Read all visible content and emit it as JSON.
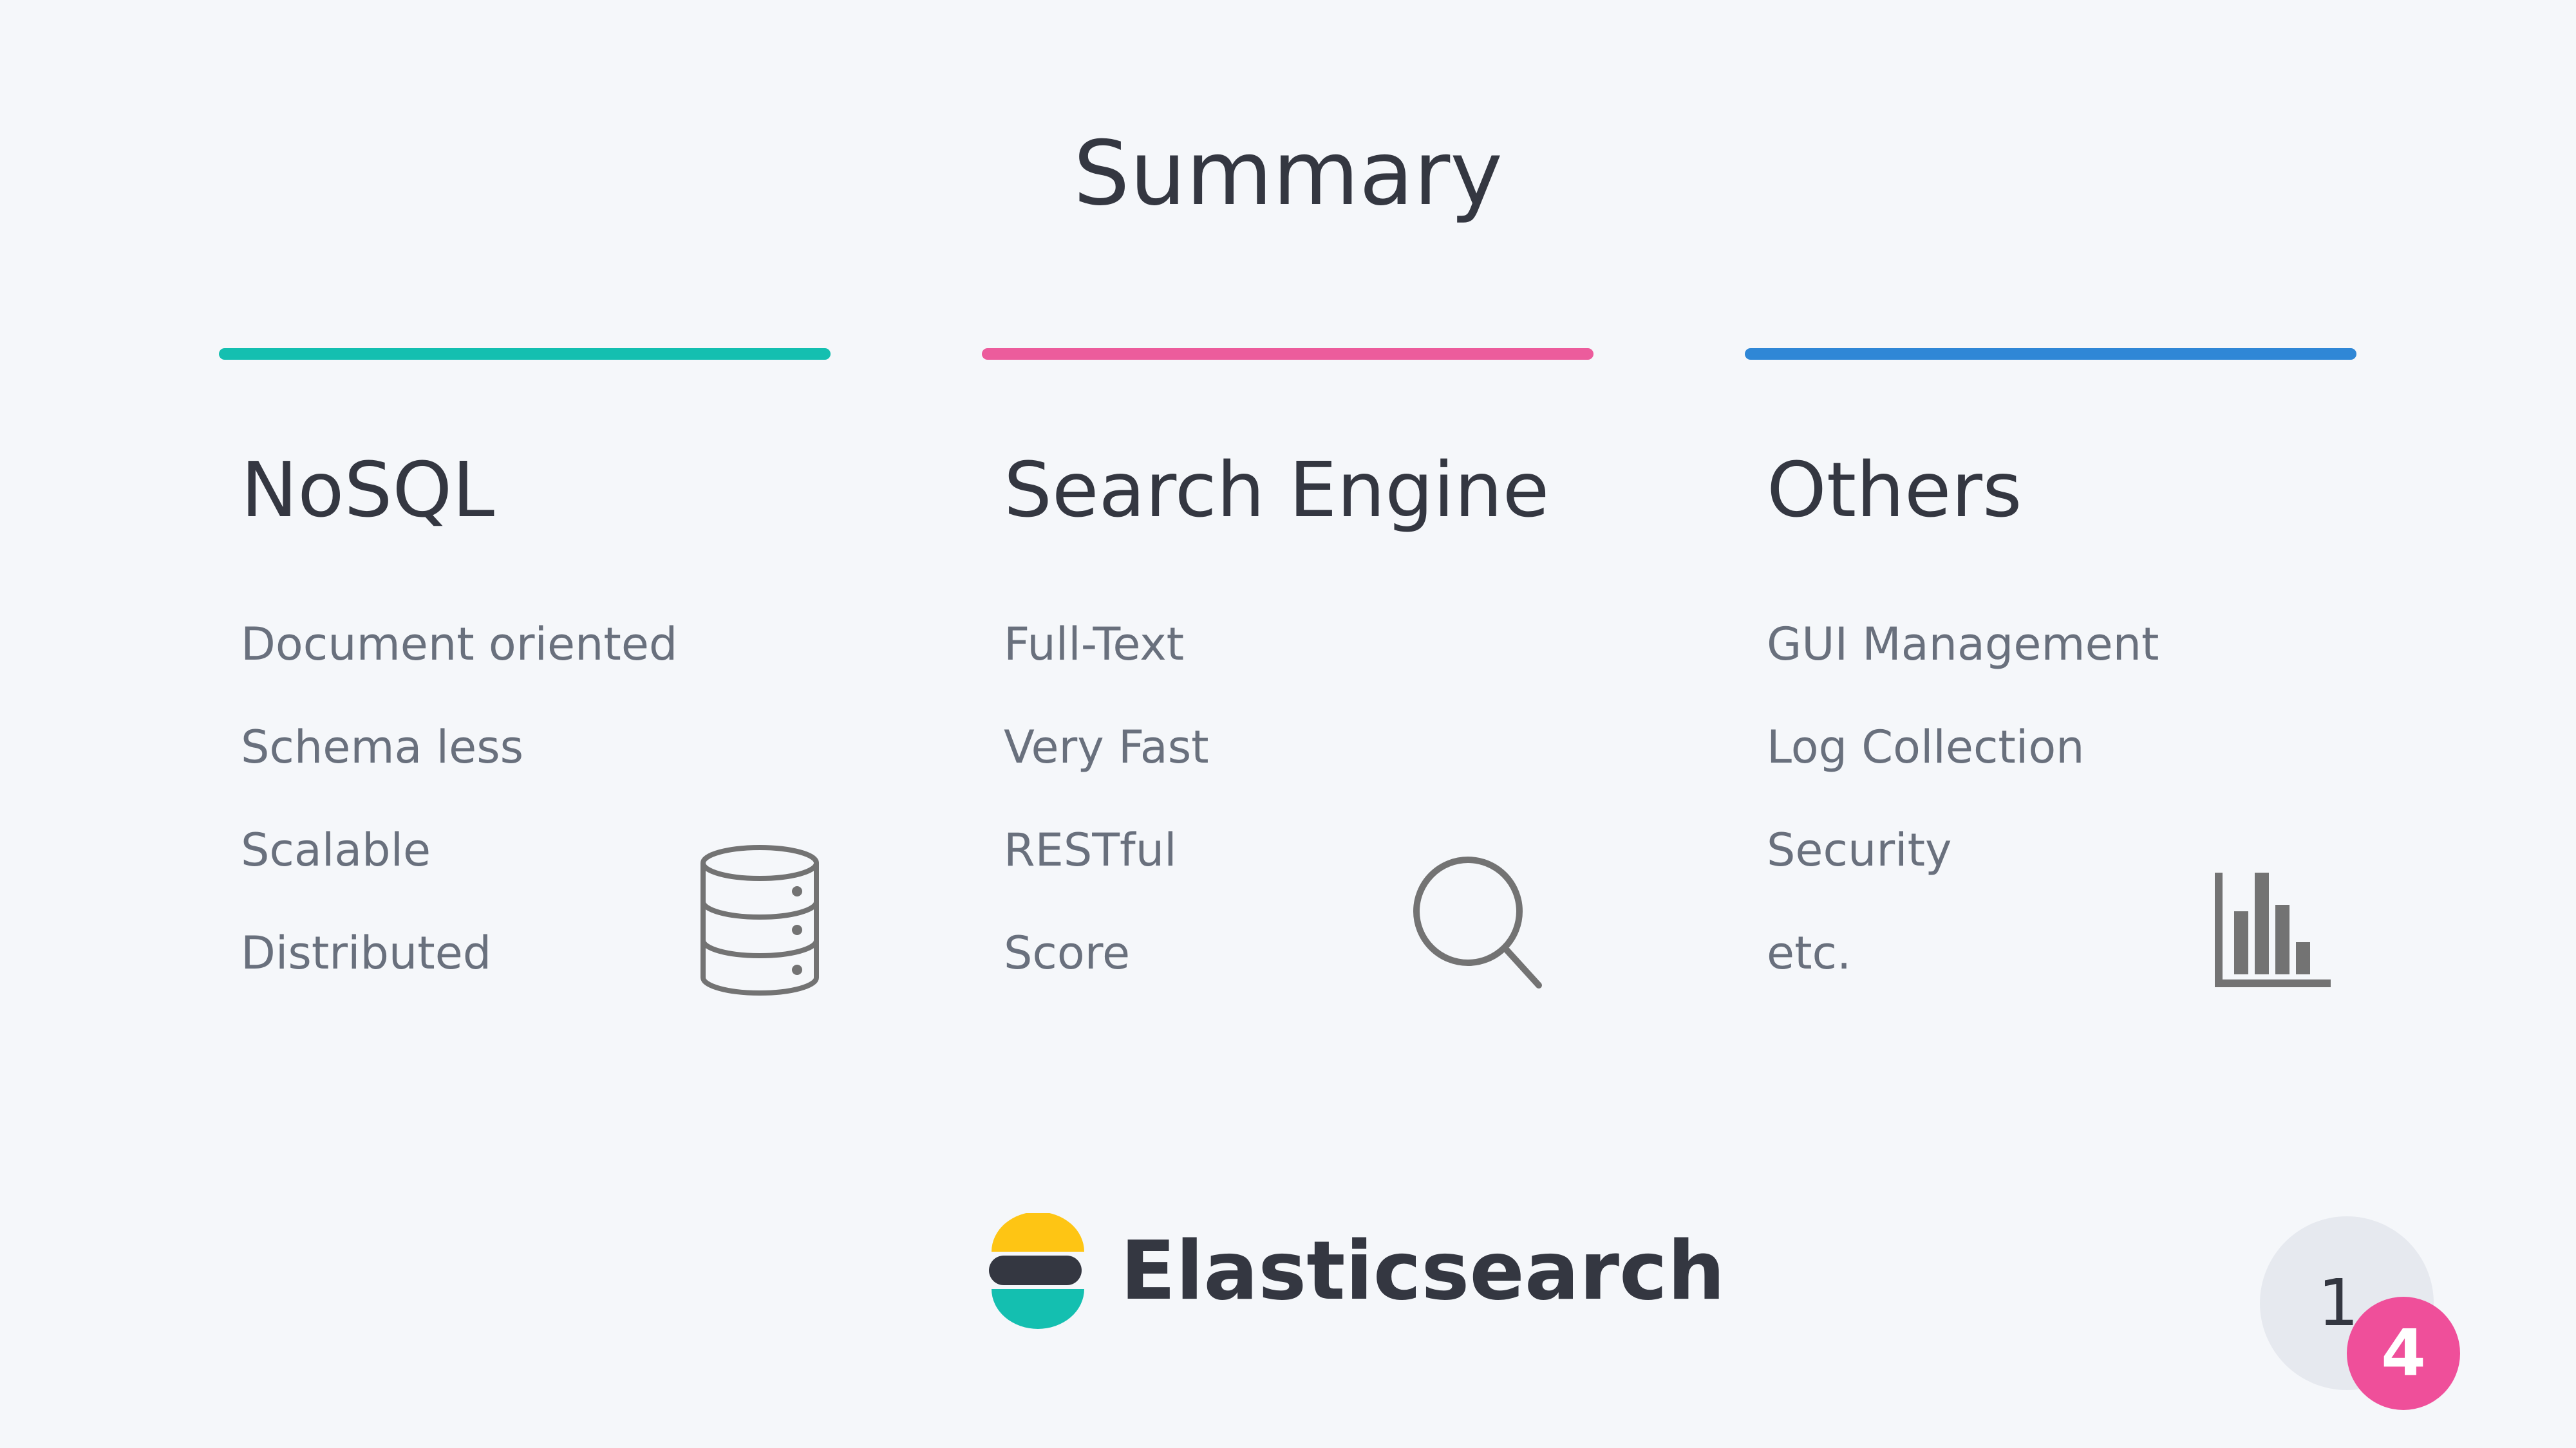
{
  "slide": {
    "title": "Summary"
  },
  "columns": [
    {
      "heading": "NoSQL",
      "accent_color": "#14bfb0",
      "items": [
        "Document oriented",
        "Schema less",
        "Scalable",
        "Distributed"
      ],
      "icon": "database-icon"
    },
    {
      "heading": "Search Engine",
      "accent_color": "#ec5c9c",
      "items": [
        "Full-Text",
        "Very Fast",
        "RESTful",
        "Score"
      ],
      "icon": "search-icon"
    },
    {
      "heading": "Others",
      "accent_color": "#2f87d6",
      "items": [
        "GUI Management",
        "Log Collection",
        "Security",
        "etc."
      ],
      "icon": "bar-chart-icon"
    }
  ],
  "brand": {
    "name": "Elasticsearch",
    "logo_colors": {
      "top": "#fec514",
      "middle": "#343741",
      "bottom": "#14bfb0"
    }
  },
  "pagination": {
    "page_number": "1",
    "badge_count": "4",
    "badge_color": "#ef4f9a"
  },
  "colors": {
    "background": "#f5f7fa",
    "heading_text": "#343741",
    "body_text": "#69707d",
    "icon_stroke": "#737373"
  }
}
